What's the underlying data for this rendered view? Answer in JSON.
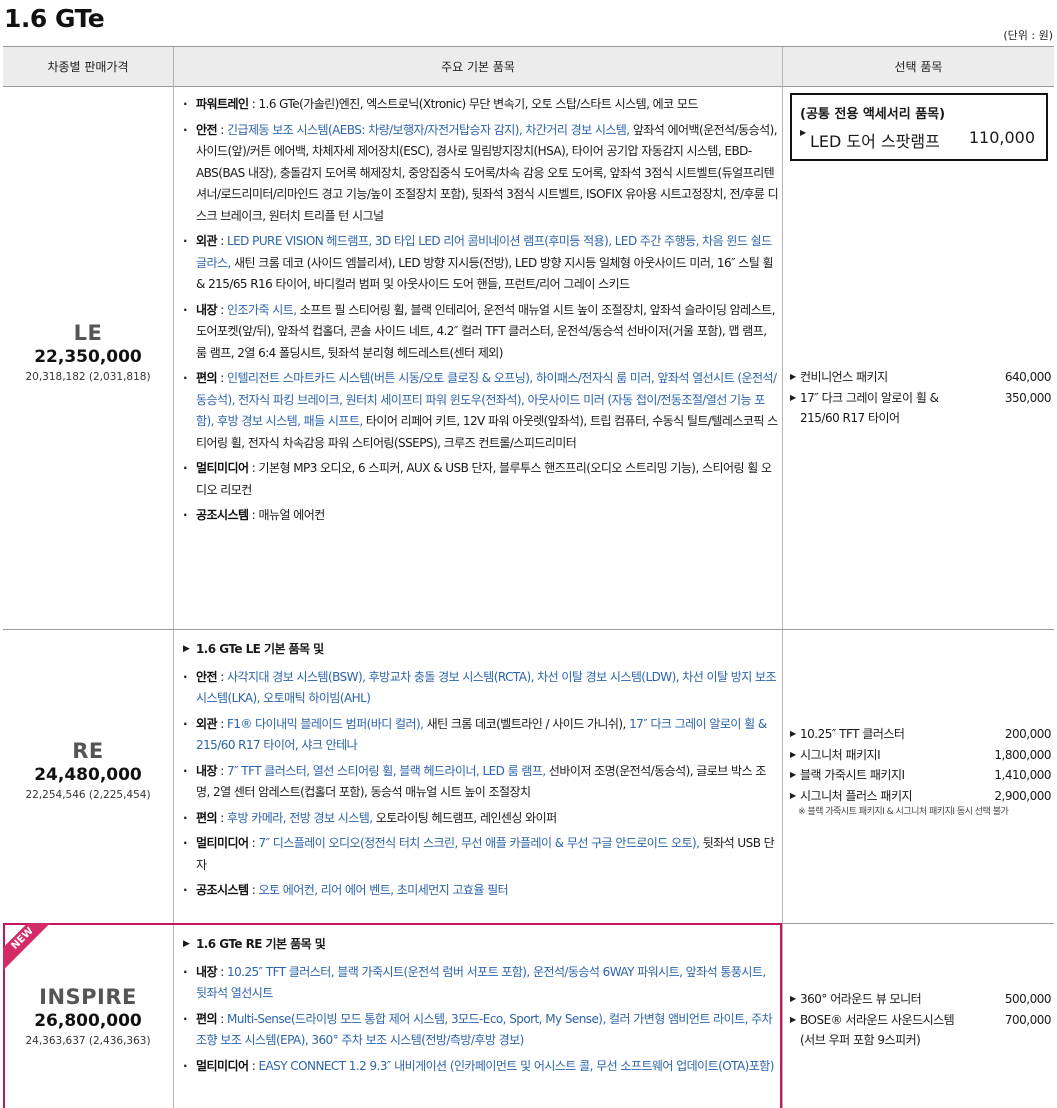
{
  "title": "1.6 GTe",
  "unit_note": "(단위 : 원)",
  "headers": {
    "trim": "차종별 판매가격",
    "features": "주요 기본 품목",
    "options": "선택 품목"
  },
  "accessory": {
    "title": "(공통 전용 액세서리 품목)",
    "item": "LED 도어 스팟램프",
    "price": "110,000"
  },
  "badge_new": "NEW",
  "trims": {
    "le": {
      "name": "LE",
      "price": "22,350,000",
      "sub": "20,318,182 (2,031,818)",
      "groups": {
        "powertrain": {
          "label": "파워트레인",
          "text": " : 1.6 GTe(가솔린)엔진, 엑스트로닉(Xtronic) 무단 변속기, 오토 스탑/스타트 시스템, 에코 모드"
        },
        "safety": {
          "label": "안전",
          "hl": "긴급제동 보조 시스템(AEBS: 차량/보행자/자전거탑승자 감지), 차간거리 경보 시스템,",
          "text": "앞좌석 에어백(운전석/동승석), 사이드(앞)/커튼 에어백, 차체자세 제어장치(ESC), 경사로 밀림방지장치(HSA), 타이어 공기압 자동감지 시스템, EBD-ABS(BAS 내장), 충돌감지 도어록 해제장치, 중앙집중식 도어록/차속 감응 오토 도어록, 앞좌석 3점식 시트벨트(듀얼프리텐셔너/로드리미터/리마인드 경고 기능/높이 조절장치 포함), 뒷좌석 3점식 시트벨트, ISOFIX 유아용 시트고정장치, 전/후륜 디스크 브레이크, 원터치 트리플 턴 시그널"
        },
        "exterior": {
          "label": "외관",
          "hl": "LED PURE VISION 헤드램프, 3D 타입 LED 리어 콤비네이션 램프(후미등 적용), LED 주간 주행등, 차음 윈드 쉴드 글라스,",
          "text": " 새틴 크롬 데코 (사이드 엠블리셔), LED 방향 지시등(전방), LED 방향 지시등 일체형 아웃사이드 미러, 16″ 스틸 휠 & 215/65 R16 타이어, 바디컬러 범퍼 및 아웃사이드 도어 핸들, 프런트/리어 그레이 스키드"
        },
        "interior": {
          "label": "내장",
          "hl": "인조가죽 시트,",
          "text": " 소프트 필 스티어링 휠, 블랙 인테리어, 운전석 매뉴얼 시트 높이 조절장치, 앞좌석 슬라이딩 암레스트, 도어포켓(앞/뒤), 앞좌석 컵홀더, 콘솔 사이드 네트, 4.2″ 컬러 TFT 클러스터, 운전석/동승석 선바이저(거울 포함), 맵 램프, 룸 램프, 2열 6:4 폴딩시트, 뒷좌석 분리형 헤드레스트(센터 제외)"
        },
        "convenience": {
          "label": "편의",
          "hl": "인텔리전트 스마트카드 시스템(버튼 시동/오토 클로징 & 오프닝), 하이패스/전자식 룸 미러, 앞좌석 열선시트 (운전석/동승석), 전자식 파킹 브레이크, 원터치 세이프티 파워 윈도우(전좌석), 아웃사이드 미러 (자동 접이/전동조절/열선 기능 포함), 후방 경보 시스템, 패들 시프트,",
          "text": " 타이어 리페어 키트, 12V 파워 아웃렛(앞좌석), 트립 컴퓨터, 수동식 틸트/텔레스코픽 스티어링 휠, 전자식 차속감응 파워 스티어링(SSEPS), 크루즈 컨트롤/스피드리미터"
        },
        "multimedia": {
          "label": "멀티미디어",
          "text": " : 기본형 MP3 오디오, 6 스피커, AUX & USB 단자, 블루투스 핸즈프리(오디오 스트리밍 기능), 스티어링 휠 오디오 리모컨"
        },
        "climate": {
          "label": "공조시스템",
          "text": " : 매뉴얼 에어컨"
        }
      },
      "options": [
        {
          "name": "컨비니언스 패키지",
          "price": "640,000"
        },
        {
          "name": "17″ 다크 그레이 알로이 휠 & 215/60 R17 타이어",
          "price": "350,000"
        }
      ]
    },
    "re": {
      "name": "RE",
      "price": "24,480,000",
      "sub": "22,254,546 (2,225,454)",
      "base": "1.6 GTe LE 기본 품목 및",
      "groups": {
        "safety": {
          "label": "안전",
          "hl": "사각지대 경보 시스템(BSW), 후방교차 충돌 경보 시스템(RCTA), 차선 이탈 경보 시스템(LDW), 차선 이탈 방지 보조 시스템(LKA), 오토매틱 하이빔(AHL)"
        },
        "exterior": {
          "label": "외관",
          "hl": "F1® 다이내믹 블레이드 범퍼(바디 컬러),",
          "text": " 새틴 크롬 데코(벨트라인 / 사이드 가니쉬),",
          "hl2": " 17″ 다크 그레이 알로이 휠 & 215/60 R17 타이어, 샤크 안테나"
        },
        "interior": {
          "label": "내장",
          "hl": "7″ TFT 클러스터, 열선 스티어링 휠, 블랙 헤드라이너, LED 룸 램프,",
          "text": " 선바이저 조명(운전석/동승석), 글로브 박스 조명, 2열 센터 암레스트(컵홀더 포함), 동승석 매뉴얼 시트 높이 조절장치"
        },
        "convenience": {
          "label": "편의",
          "hl": "후방 카메라, 전방 경보 시스템,",
          "text": " 오토라이팅 헤드램프, 레인센싱 와이퍼"
        },
        "multimedia": {
          "label": "멀티미디어",
          "hl": "7″ 디스플레이 오디오(정전식 터치 스크린, 무선 애플 카플레이 & 무선 구글 안드로이드 오토),",
          "text": " 뒷좌석 USB 단자"
        },
        "climate": {
          "label": "공조시스템",
          "hl": "오토 에어컨, 리어 에어 벤트, 초미세먼지 고효율 필터"
        }
      },
      "options": [
        {
          "name": "10.25″ TFT 클러스터",
          "price": "200,000"
        },
        {
          "name": "시그니처 패키지Ⅰ",
          "price": "1,800,000"
        },
        {
          "name": "블랙 가죽시트 패키지Ⅰ",
          "price": "1,410,000"
        },
        {
          "name": "시그니처 플러스 패키지",
          "price": "2,900,000"
        }
      ],
      "option_note": "※ 블랙 가죽시트 패키지Ⅰ & 시그니처 패키지Ⅰ 동시 선택 불가"
    },
    "inspire": {
      "name": "INSPIRE",
      "price": "26,800,000",
      "sub": "24,363,637 (2,436,363)",
      "base": "1.6 GTe RE 기본 품목 및",
      "groups": {
        "interior": {
          "label": "내장",
          "hl": "10.25″ TFT 클러스터, 블랙 가죽시트(운전석 럼버 서포트 포함), 운전석/동승석 6WAY 파워시트, 앞좌석 통풍시트, 뒷좌석 열선시트"
        },
        "convenience": {
          "label": "편의",
          "hl": "Multi-Sense(드라이빙 모드 통합 제어 시스템, 3모드-Eco, Sport, My Sense), 컬러 가변형 앰비언트 라이트, 주차 조향 보조 시스템(EPA), 360° 주차 보조 시스템(전방/측방/후방 경보)"
        },
        "multimedia": {
          "label": "멀티미디어",
          "hl": "EASY CONNECT 1.2 9.3″ 내비게이션 (인카페이먼트 및 어시스트 콜, 무선 소프트웨어 업데이트(OTA)포함)"
        }
      },
      "options": [
        {
          "name": "360° 어라운드 뷰 모니터",
          "price": "500,000"
        },
        {
          "name": "BOSE® 서라운드 사운드시스템 (서브 우퍼 포함 9스피커)",
          "price": "700,000"
        }
      ]
    }
  }
}
